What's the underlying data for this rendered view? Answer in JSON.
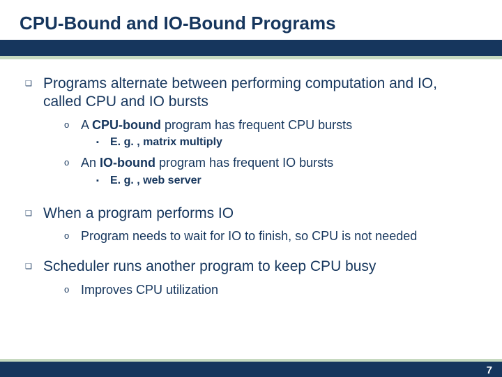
{
  "title": "CPU-Bound and IO-Bound Programs",
  "points": {
    "p1": "Programs alternate between performing computation and IO, called CPU and IO bursts",
    "p1a_pre": "A ",
    "p1a_bold": "CPU-bound",
    "p1a_post": " program has frequent CPU bursts",
    "p1a_eg": "E. g. , matrix multiply",
    "p1b_pre": "An ",
    "p1b_bold": "IO-bound",
    "p1b_post": " program has frequent IO bursts",
    "p1b_eg": "E. g. , web server",
    "p2": "When a program performs IO",
    "p2a": "Program needs to wait for IO to finish, so CPU is not needed",
    "p3": "Scheduler runs another program to keep CPU busy",
    "p3a": "Improves CPU utilization"
  },
  "bullets": {
    "square": "❑",
    "circle": "o",
    "blksq": "▪"
  },
  "page": "7"
}
